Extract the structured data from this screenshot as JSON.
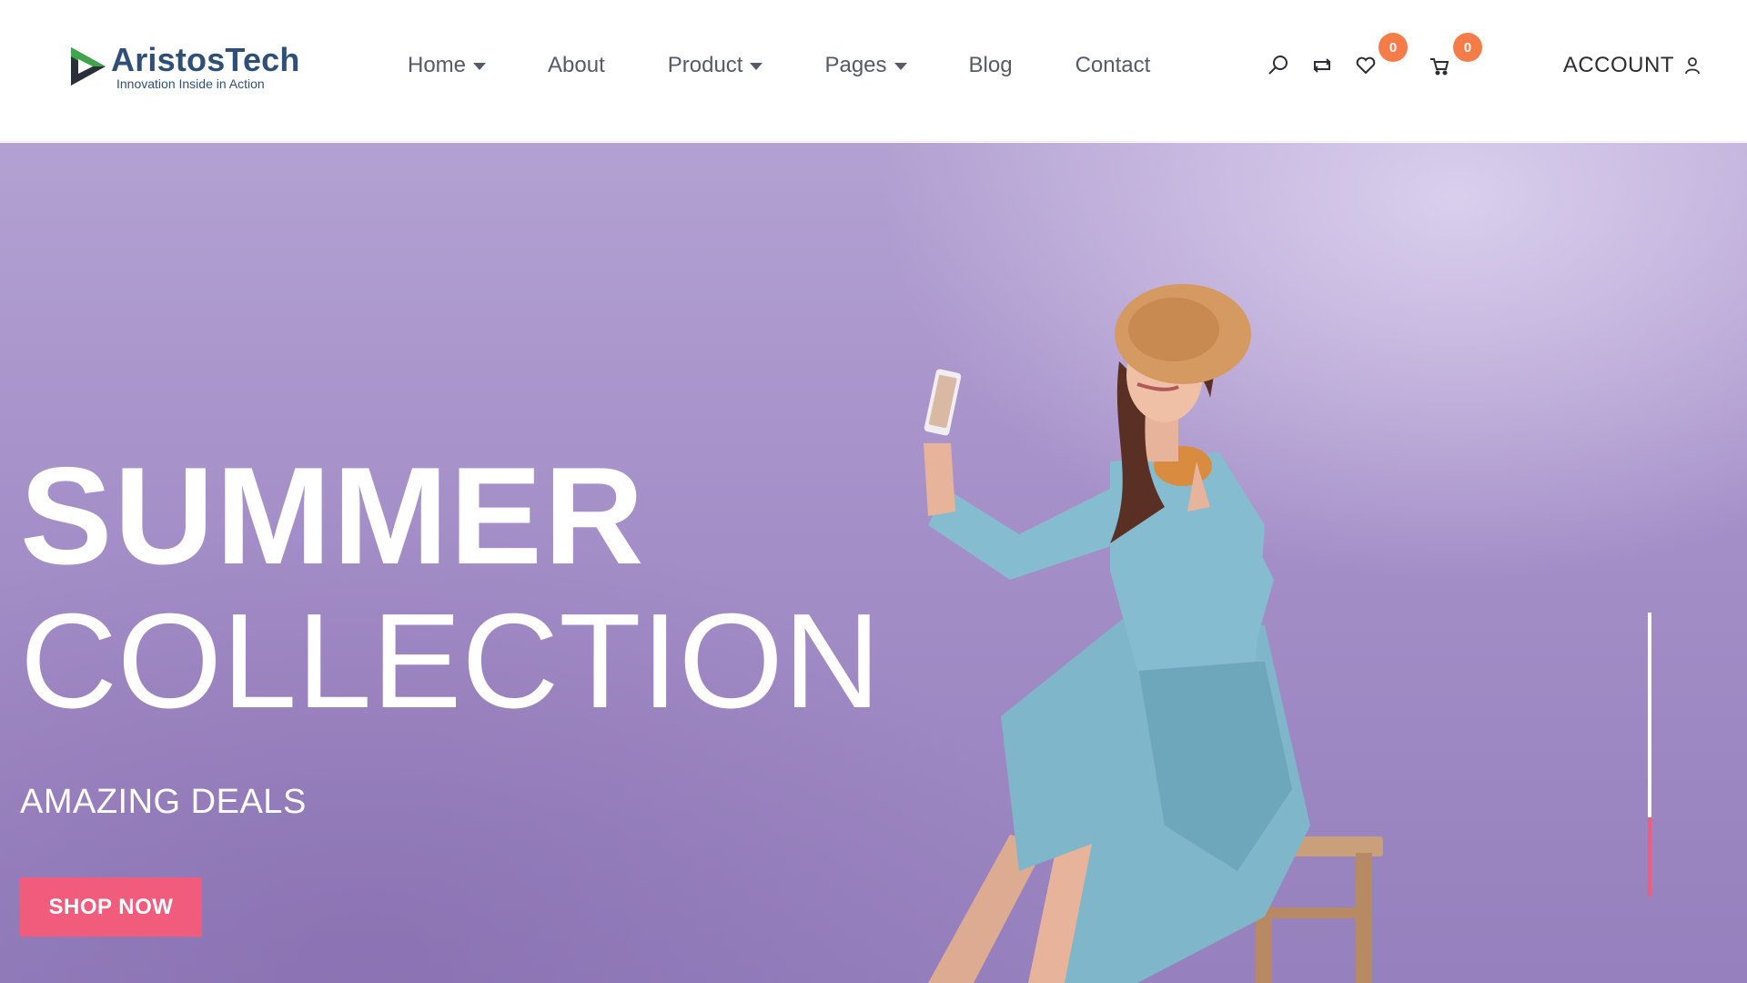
{
  "brand": {
    "name": "AristosTech",
    "tagline": "Innovation Inside in Action",
    "colors": {
      "primary": "#2f4f77",
      "mark_green": "#3fa44a",
      "mark_dark": "#2b2f3a"
    }
  },
  "nav": {
    "items": [
      {
        "label": "Home",
        "has_dropdown": true
      },
      {
        "label": "About",
        "has_dropdown": false
      },
      {
        "label": "Product",
        "has_dropdown": true
      },
      {
        "label": "Pages",
        "has_dropdown": true
      },
      {
        "label": "Blog",
        "has_dropdown": false
      },
      {
        "label": "Contact",
        "has_dropdown": false
      }
    ]
  },
  "header_icons": {
    "search": "search-icon",
    "compare": "compare-icon",
    "wishlist": {
      "icon": "heart-icon",
      "count": "0"
    },
    "cart": {
      "icon": "cart-icon",
      "count": "0"
    }
  },
  "account": {
    "label": "ACCOUNT",
    "icon": "user-icon"
  },
  "hero": {
    "title_line1": "SUMMER",
    "title_line2": "COLLECTION",
    "subtitle": "AMAZING DEALS",
    "cta_label": "SHOP NOW",
    "slider_progress": 0.28,
    "colors": {
      "accent": "#f25c7c",
      "badge": "#f47c48",
      "background": "#a58fc8"
    }
  }
}
